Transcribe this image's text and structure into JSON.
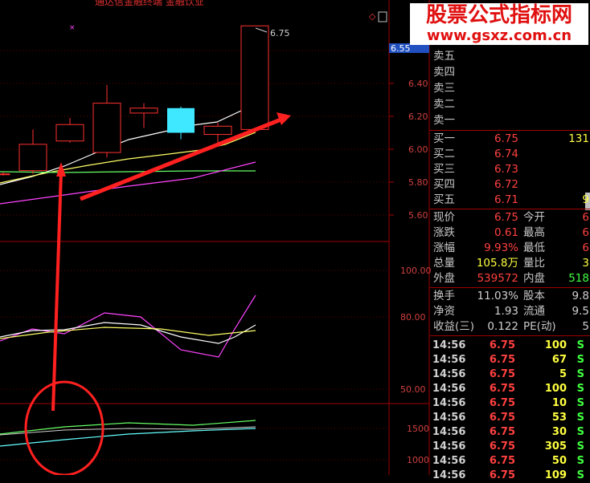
{
  "watermark": {
    "line1": "股票公式指标网",
    "line2": "www.gsxz.com.cn"
  },
  "topbar": {
    "title": "通达信金融终端 金融饮业"
  },
  "chart": {
    "last_price_label": "6.75",
    "price_tag": "6.55",
    "price_axis": [
      "6.40",
      "6.20",
      "6.00",
      "5.80",
      "5.60"
    ],
    "osc_axis": [
      "100.00",
      "80.00",
      "50.00"
    ],
    "vol_axis": [
      "1500",
      "1000"
    ],
    "candles": [
      {
        "o": 5.85,
        "c": 5.85,
        "h": 5.86,
        "l": 5.84
      },
      {
        "o": 5.87,
        "c": 6.03,
        "h": 6.12,
        "l": 5.85
      },
      {
        "o": 6.05,
        "c": 6.15,
        "h": 6.19,
        "l": 6.04
      },
      {
        "o": 5.98,
        "c": 6.28,
        "h": 6.39,
        "l": 5.95
      },
      {
        "o": 6.22,
        "c": 6.25,
        "h": 6.28,
        "l": 6.13
      },
      {
        "o": 6.25,
        "c": 6.1,
        "h": 6.26,
        "l": 6.06
      },
      {
        "o": 6.09,
        "c": 6.14,
        "h": 6.16,
        "l": 6.03
      },
      {
        "o": 6.12,
        "c": 6.75,
        "h": 6.75,
        "l": 6.12
      }
    ]
  },
  "quote": {
    "asks": [
      {
        "label": "卖五",
        "price": "",
        "vol": ""
      },
      {
        "label": "卖四",
        "price": "",
        "vol": ""
      },
      {
        "label": "卖三",
        "price": "",
        "vol": ""
      },
      {
        "label": "卖二",
        "price": "",
        "vol": ""
      },
      {
        "label": "卖一",
        "price": "",
        "vol": ""
      }
    ],
    "bids": [
      {
        "label": "买一",
        "price": "6.75",
        "vol": "131"
      },
      {
        "label": "买二",
        "price": "6.74",
        "vol": ""
      },
      {
        "label": "买三",
        "price": "6.73",
        "vol": ""
      },
      {
        "label": "买四",
        "price": "6.72",
        "vol": ""
      },
      {
        "label": "买五",
        "price": "6.71",
        "vol": "9"
      }
    ],
    "stats": [
      {
        "l1": "现价",
        "v1": "6.75",
        "l2": "今开",
        "v2": "6"
      },
      {
        "l1": "涨跌",
        "v1": "0.61",
        "l2": "最高",
        "v2": "6"
      },
      {
        "l1": "涨幅",
        "v1": "9.93%",
        "l2": "最低",
        "v2": "6"
      },
      {
        "l1": "总量",
        "v1": "105.8万",
        "l2": "量比",
        "v2": "3"
      },
      {
        "l1": "外盘",
        "v1": "539572",
        "l2": "内盘",
        "v2": "518"
      }
    ],
    "stats2": [
      {
        "l1": "换手",
        "v1": "11.03%",
        "l2": "股本",
        "v2": "9.8"
      },
      {
        "l1": "净资",
        "v1": "1.93",
        "l2": "流通",
        "v2": "9.5"
      },
      {
        "l1": "收益(三)",
        "v1": "0.122",
        "l2": "PE(动)",
        "v2": "5"
      }
    ],
    "ticks": [
      {
        "t": "14:56",
        "p": "6.75",
        "v": "100",
        "f": "S"
      },
      {
        "t": "14:56",
        "p": "6.75",
        "v": "67",
        "f": "S"
      },
      {
        "t": "14:56",
        "p": "6.75",
        "v": "5",
        "f": "S"
      },
      {
        "t": "14:56",
        "p": "6.75",
        "v": "100",
        "f": "S"
      },
      {
        "t": "14:56",
        "p": "6.75",
        "v": "10",
        "f": "S"
      },
      {
        "t": "14:56",
        "p": "6.75",
        "v": "53",
        "f": "S"
      },
      {
        "t": "14:56",
        "p": "6.75",
        "v": "30",
        "f": "S"
      },
      {
        "t": "14:56",
        "p": "6.75",
        "v": "305",
        "f": "S"
      },
      {
        "t": "14:56",
        "p": "6.75",
        "v": "50",
        "f": "S"
      },
      {
        "t": "14:56",
        "p": "6.75",
        "v": "109",
        "f": "S"
      }
    ]
  }
}
